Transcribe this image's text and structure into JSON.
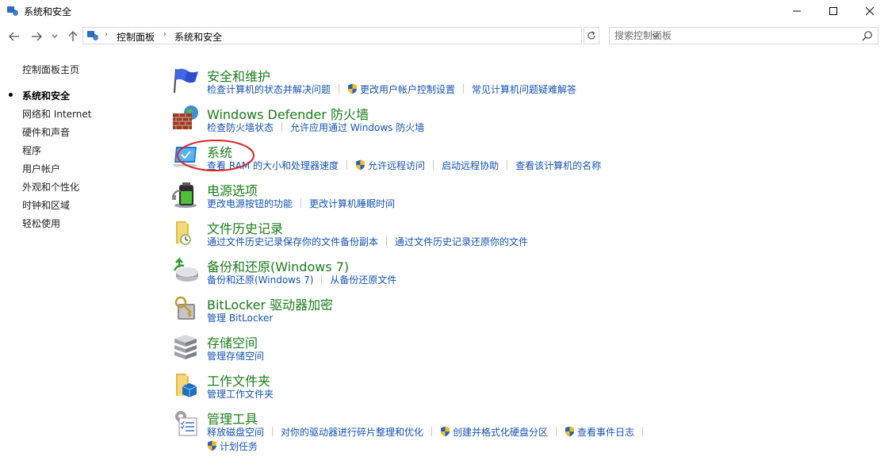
{
  "window": {
    "title": "系统和安全"
  },
  "breadcrumb": {
    "items": [
      "控制面板",
      "系统和安全"
    ]
  },
  "search": {
    "placeholder": "搜索控制面板"
  },
  "sidebar": {
    "home": "控制面板主页",
    "items": [
      {
        "label": "系统和安全",
        "active": true
      },
      {
        "label": "网络和 Internet"
      },
      {
        "label": "硬件和声音"
      },
      {
        "label": "程序"
      },
      {
        "label": "用户帐户"
      },
      {
        "label": "外观和个性化"
      },
      {
        "label": "时钟和区域"
      },
      {
        "label": "轻松使用"
      }
    ]
  },
  "categories": [
    {
      "title": "安全和维护",
      "icon": "flag-icon",
      "links": [
        "检查计算机的状态并解决问题",
        "更改用户帐户控制设置",
        "常见计算机问题疑难解答"
      ]
    },
    {
      "title": "Windows Defender 防火墙",
      "icon": "firewall-icon",
      "links": [
        "检查防火墙状态",
        "允许应用通过 Windows 防火墙"
      ]
    },
    {
      "title": "系统",
      "icon": "computer-icon",
      "links": [
        "查看 RAM 的大小和处理器速度",
        "允许远程访问",
        "启动远程协助",
        "查看该计算机的名称"
      ]
    },
    {
      "title": "电源选项",
      "icon": "battery-icon",
      "links": [
        "更改电源按钮的功能",
        "更改计算机睡眠时间"
      ]
    },
    {
      "title": "文件历史记录",
      "icon": "folder-clock-icon",
      "links": [
        "通过文件历史记录保存你的文件备份副本",
        "通过文件历史记录还原你的文件"
      ]
    },
    {
      "title": "备份和还原(Windows 7)",
      "icon": "backup-icon",
      "links": [
        "备份和还原(Windows 7)",
        "从备份还原文件"
      ]
    },
    {
      "title": "BitLocker 驱动器加密",
      "icon": "bitlocker-icon",
      "links": [
        "管理 BitLocker"
      ]
    },
    {
      "title": "存储空间",
      "icon": "storage-icon",
      "links": [
        "管理存储空间"
      ]
    },
    {
      "title": "工作文件夹",
      "icon": "work-folder-icon",
      "links": [
        "管理工作文件夹"
      ]
    },
    {
      "title": "管理工具",
      "icon": "admin-tools-icon",
      "links": [
        "释放磁盘空间",
        "对你的驱动器进行碎片整理和优化",
        "创建并格式化硬盘分区",
        "查看事件日志",
        "计划任务"
      ]
    }
  ],
  "colors": {
    "title_green": "#1a7d1a",
    "link_blue": "#1453b4",
    "annotation_red": "#d9262b"
  }
}
